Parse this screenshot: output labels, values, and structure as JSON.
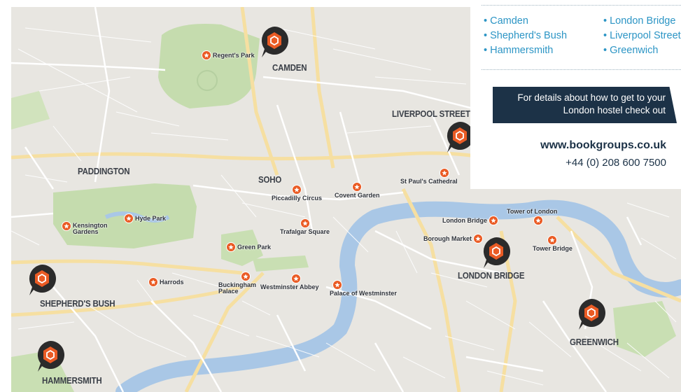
{
  "map": {
    "areas": [
      {
        "id": "camden",
        "label": "CAMDEN"
      },
      {
        "id": "liverpool",
        "label": "LIVERPOOL STREET"
      },
      {
        "id": "paddington",
        "label": "PADDINGTON"
      },
      {
        "id": "soho",
        "label": "SOHO"
      },
      {
        "id": "london-bridge",
        "label": "LONDON BRIDGE"
      },
      {
        "id": "shepherds",
        "label": "SHEPHERD'S BUSH"
      },
      {
        "id": "greenwich",
        "label": "GREENWICH"
      },
      {
        "id": "hammersmith",
        "label": "HAMMERSMITH"
      }
    ],
    "landmarks": [
      {
        "id": "regents-park",
        "label": "Regent's Park"
      },
      {
        "id": "kensington",
        "label": "Kensington Gardens"
      },
      {
        "id": "hyde-park",
        "label": "Hyde Park"
      },
      {
        "id": "piccadilly",
        "label": "Piccadilly Circus"
      },
      {
        "id": "covent-garden",
        "label": "Covent Garden"
      },
      {
        "id": "st-pauls",
        "label": "St Paul's Cathedral"
      },
      {
        "id": "trafalgar",
        "label": "Trafalgar Square"
      },
      {
        "id": "green-park",
        "label": "Green Park"
      },
      {
        "id": "tower-of-london",
        "label": "Tower of London"
      },
      {
        "id": "london-bridge-poi",
        "label": "London Bridge"
      },
      {
        "id": "borough-market",
        "label": "Borough Market"
      },
      {
        "id": "tower-bridge",
        "label": "Tower Bridge"
      },
      {
        "id": "harrods",
        "label": "Harrods"
      },
      {
        "id": "buckingham",
        "label": "Buckingham Palace"
      },
      {
        "id": "westminster-abbey",
        "label": "Westminster Abbey"
      },
      {
        "id": "palace-westminster",
        "label": "Palace of Westminster"
      }
    ],
    "marker_icon": "hostel-pin-icon",
    "landmark_icon": "star-icon"
  },
  "panel": {
    "locations_left": [
      "• Camden",
      "• Shepherd's Bush",
      "• Hammersmith"
    ],
    "locations_right": [
      "• London Bridge",
      "• Liverpool Street",
      "• Greenwich"
    ],
    "banner_line1": "For details about how to get to your",
    "banner_line2": "London hostel check out",
    "website": "www.bookgroups.co.uk",
    "phone": "+44 (0) 208 600 7500"
  },
  "colors": {
    "accent_orange": "#ea5b24",
    "marker_dark": "#2b2b2b",
    "river": "#a9c7e6",
    "park": "#c5dcae",
    "panel_link": "#2c95c5",
    "banner": "#1c3247"
  }
}
